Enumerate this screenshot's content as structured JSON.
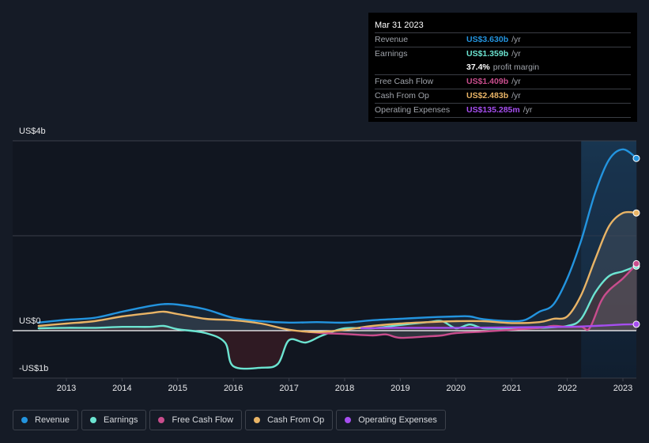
{
  "tooltip": {
    "date": "Mar 31 2023",
    "rows": [
      {
        "label": "Revenue",
        "value": "US$3.630b",
        "unit": "/yr",
        "color": "#2394df"
      },
      {
        "label": "Earnings",
        "value": "US$1.359b",
        "unit": "/yr",
        "color": "#6ce4d1"
      },
      {
        "label": "",
        "value": "37.4%",
        "unit": "profit margin",
        "color": "#ffffff"
      },
      {
        "label": "Free Cash Flow",
        "value": "US$1.409b",
        "unit": "/yr",
        "color": "#c94d8d"
      },
      {
        "label": "Cash From Op",
        "value": "US$2.483b",
        "unit": "/yr",
        "color": "#e9b466"
      },
      {
        "label": "Operating Expenses",
        "value": "US$135.285m",
        "unit": "/yr",
        "color": "#a64ef0"
      }
    ]
  },
  "legend": [
    {
      "label": "Revenue",
      "color": "#2394df"
    },
    {
      "label": "Earnings",
      "color": "#6ce4d1"
    },
    {
      "label": "Free Cash Flow",
      "color": "#c94d8d"
    },
    {
      "label": "Cash From Op",
      "color": "#e9b466"
    },
    {
      "label": "Operating Expenses",
      "color": "#a64ef0"
    }
  ],
  "chart_data": {
    "type": "line",
    "title": "",
    "xlabel": "",
    "ylabel": "",
    "y_tick_labels": [
      {
        "value": 4,
        "label": "US$4b"
      },
      {
        "value": 0,
        "label": "US$0"
      },
      {
        "value": -1,
        "label": "-US$1b"
      }
    ],
    "ylim": [
      -1,
      4
    ],
    "xlim": [
      2012.5,
      2023.25
    ],
    "x_ticks": [
      2013,
      2014,
      2015,
      2016,
      2017,
      2018,
      2019,
      2020,
      2021,
      2022,
      2023
    ],
    "x_tick_labels": [
      "2013",
      "2014",
      "2015",
      "2016",
      "2017",
      "2018",
      "2019",
      "2020",
      "2021",
      "2022",
      "2023"
    ],
    "gridlines_y": [
      4,
      2,
      -1
    ],
    "highlight_from": 2022.25,
    "units": "US$ billions",
    "series": [
      {
        "name": "Revenue",
        "color": "#2394df",
        "points": [
          [
            2012.5,
            0.17
          ],
          [
            2013,
            0.23
          ],
          [
            2013.5,
            0.27
          ],
          [
            2014,
            0.4
          ],
          [
            2014.5,
            0.52
          ],
          [
            2014.75,
            0.56
          ],
          [
            2015,
            0.55
          ],
          [
            2015.5,
            0.45
          ],
          [
            2016,
            0.27
          ],
          [
            2016.5,
            0.2
          ],
          [
            2017,
            0.17
          ],
          [
            2017.5,
            0.18
          ],
          [
            2018,
            0.17
          ],
          [
            2018.5,
            0.22
          ],
          [
            2019,
            0.25
          ],
          [
            2019.5,
            0.28
          ],
          [
            2020,
            0.3
          ],
          [
            2020.25,
            0.3
          ],
          [
            2020.5,
            0.24
          ],
          [
            2021,
            0.2
          ],
          [
            2021.25,
            0.23
          ],
          [
            2021.5,
            0.4
          ],
          [
            2021.75,
            0.55
          ],
          [
            2022,
            1.1
          ],
          [
            2022.25,
            1.9
          ],
          [
            2022.5,
            2.9
          ],
          [
            2022.75,
            3.6
          ],
          [
            2023,
            3.82
          ],
          [
            2023.25,
            3.63
          ]
        ]
      },
      {
        "name": "Earnings",
        "color": "#6ce4d1",
        "points": [
          [
            2012.5,
            0.05
          ],
          [
            2013,
            0.06
          ],
          [
            2013.5,
            0.06
          ],
          [
            2014,
            0.08
          ],
          [
            2014.5,
            0.08
          ],
          [
            2014.75,
            0.1
          ],
          [
            2015,
            0.03
          ],
          [
            2015.5,
            -0.05
          ],
          [
            2015.85,
            -0.25
          ],
          [
            2016,
            -0.75
          ],
          [
            2016.5,
            -0.78
          ],
          [
            2016.8,
            -0.7
          ],
          [
            2017,
            -0.2
          ],
          [
            2017.3,
            -0.25
          ],
          [
            2017.6,
            -0.1
          ],
          [
            2018,
            0.05
          ],
          [
            2018.5,
            0.05
          ],
          [
            2019,
            0.12
          ],
          [
            2019.5,
            0.18
          ],
          [
            2019.75,
            0.2
          ],
          [
            2020,
            0.05
          ],
          [
            2020.25,
            0.13
          ],
          [
            2020.5,
            0.05
          ],
          [
            2021,
            0.05
          ],
          [
            2021.5,
            0.06
          ],
          [
            2022,
            0.1
          ],
          [
            2022.25,
            0.25
          ],
          [
            2022.5,
            0.8
          ],
          [
            2022.75,
            1.15
          ],
          [
            2023,
            1.25
          ],
          [
            2023.25,
            1.36
          ]
        ]
      },
      {
        "name": "Free Cash Flow",
        "color": "#c94d8d",
        "points": [
          [
            2017.3,
            -0.02
          ],
          [
            2017.6,
            -0.05
          ],
          [
            2018,
            -0.07
          ],
          [
            2018.5,
            -0.1
          ],
          [
            2018.75,
            -0.08
          ],
          [
            2019,
            -0.15
          ],
          [
            2019.5,
            -0.12
          ],
          [
            2019.75,
            -0.1
          ],
          [
            2020,
            -0.05
          ],
          [
            2020.5,
            -0.02
          ],
          [
            2021,
            0.02
          ],
          [
            2021.5,
            0.06
          ],
          [
            2021.75,
            0.1
          ],
          [
            2022,
            0.08
          ],
          [
            2022.25,
            0.08
          ],
          [
            2022.4,
            0.05
          ],
          [
            2022.6,
            0.6
          ],
          [
            2022.75,
            0.85
          ],
          [
            2023,
            1.1
          ],
          [
            2023.25,
            1.41
          ]
        ]
      },
      {
        "name": "Cash From Op",
        "color": "#e9b466",
        "points": [
          [
            2012.5,
            0.1
          ],
          [
            2013,
            0.15
          ],
          [
            2013.5,
            0.2
          ],
          [
            2014,
            0.3
          ],
          [
            2014.5,
            0.37
          ],
          [
            2014.75,
            0.4
          ],
          [
            2015,
            0.35
          ],
          [
            2015.5,
            0.25
          ],
          [
            2016,
            0.22
          ],
          [
            2016.5,
            0.15
          ],
          [
            2017,
            0.02
          ],
          [
            2017.5,
            -0.03
          ],
          [
            2018,
            0.02
          ],
          [
            2018.5,
            0.1
          ],
          [
            2019,
            0.15
          ],
          [
            2019.5,
            0.18
          ],
          [
            2020,
            0.2
          ],
          [
            2020.5,
            0.2
          ],
          [
            2021,
            0.16
          ],
          [
            2021.5,
            0.18
          ],
          [
            2021.75,
            0.25
          ],
          [
            2022,
            0.3
          ],
          [
            2022.25,
            0.75
          ],
          [
            2022.5,
            1.5
          ],
          [
            2022.75,
            2.2
          ],
          [
            2023,
            2.48
          ],
          [
            2023.25,
            2.48
          ]
        ]
      },
      {
        "name": "Operating Expenses",
        "color": "#a64ef0",
        "points": [
          [
            2018.3,
            0.05
          ],
          [
            2019,
            0.06
          ],
          [
            2020,
            0.06
          ],
          [
            2021,
            0.07
          ],
          [
            2022,
            0.08
          ],
          [
            2022.5,
            0.1
          ],
          [
            2023,
            0.13
          ],
          [
            2023.25,
            0.135
          ]
        ]
      }
    ]
  }
}
